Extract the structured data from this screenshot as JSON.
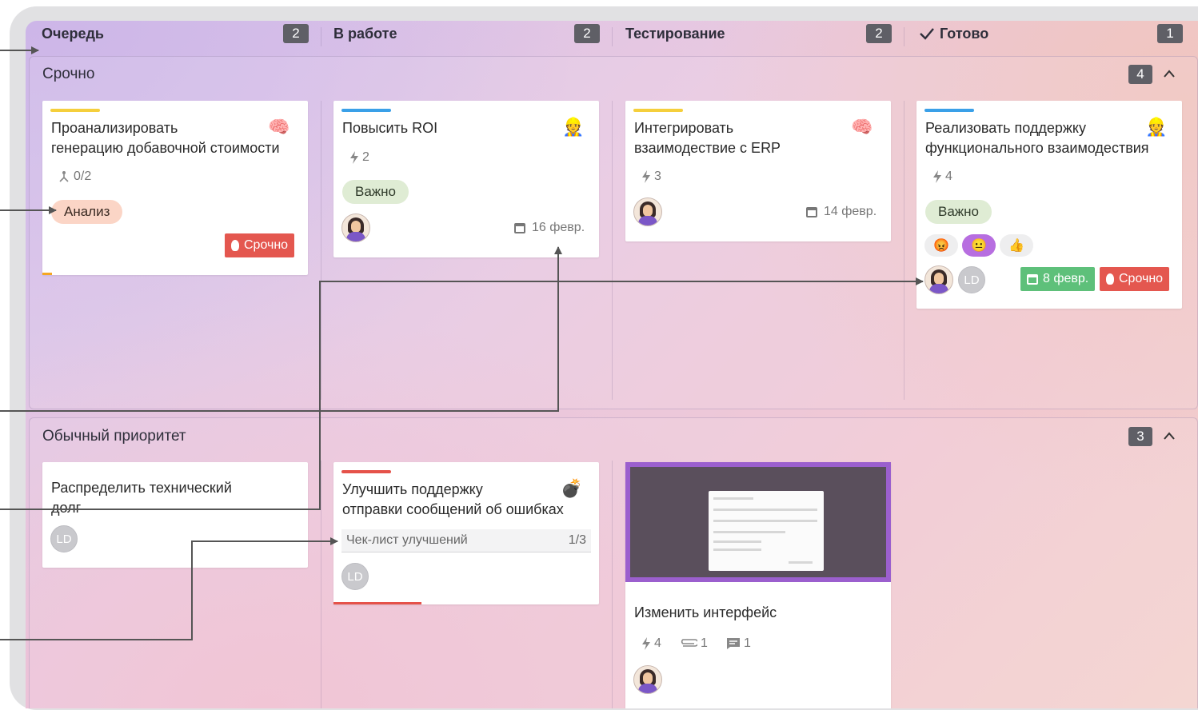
{
  "columns": [
    {
      "name": "Очередь",
      "count": "2"
    },
    {
      "name": "В работе",
      "count": "2"
    },
    {
      "name": "Тестирование",
      "count": "2"
    },
    {
      "name": "Готово",
      "count": "1",
      "icon": "check-icon"
    }
  ],
  "lanes": [
    {
      "title": "Срочно",
      "count": "4"
    },
    {
      "title": "Обычный приоритет",
      "count": "3"
    }
  ],
  "cards": {
    "c1": {
      "title_line1": "Проанализировать",
      "title_line2": "генерацию добавочной стоимости",
      "emoji": "🧠",
      "subtasks": "0/2",
      "tag": "Анализ",
      "urgent": "Срочно",
      "stripe": "#f5cf3c"
    },
    "c2": {
      "title": "Повысить ROI",
      "emoji": "👷",
      "points": "2",
      "tag": "Важно",
      "date": "16 февр.",
      "stripe": "#3aa0e8"
    },
    "c3": {
      "title_line1": "Интегрировать",
      "title_line2": "взаимодествие с ERP",
      "emoji": "🧠",
      "points": "3",
      "date": "14 февр.",
      "stripe": "#f5cf3c"
    },
    "c4": {
      "title_line1": "Реализовать поддержку",
      "title_line2": "функционального взаимодествия",
      "emoji": "👷",
      "points": "4",
      "tag": "Важно",
      "reactions": [
        "😡",
        "😐",
        "👍"
      ],
      "avatar2": "LD",
      "date": "8 февр.",
      "urgent": "Срочно",
      "stripe": "#3aa0e8"
    },
    "c5": {
      "title_line1": "Распределить технический",
      "title_line2": "долг",
      "avatar": "LD"
    },
    "c6": {
      "title_line1": "Улучшить поддержку",
      "title_line2": "отправки сообщений об ошибках",
      "emoji": "💣",
      "checklist_label": "Чек-лист улучшений",
      "checklist_count": "1/3",
      "checklist_progress": 0.33,
      "avatar": "LD",
      "stripe": "#e5524a"
    },
    "c7": {
      "title": "Изменить интерфейс",
      "points": "4",
      "attachments": "1",
      "comments": "1"
    }
  },
  "colors": {
    "urgent": "#e4574f",
    "date_green": "#5ec07a",
    "count_badge": "#5f5f66",
    "arrow": "#555555"
  }
}
